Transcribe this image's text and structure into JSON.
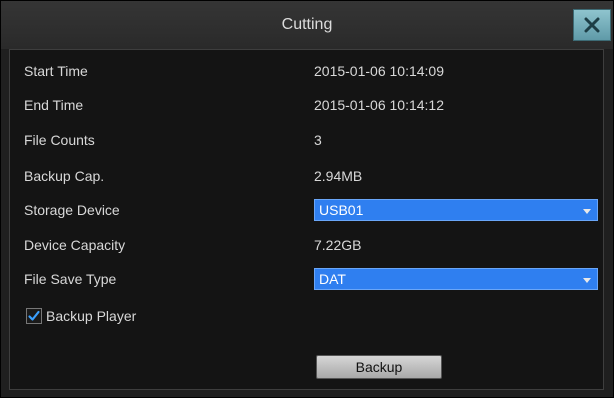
{
  "dialog": {
    "title": "Cutting",
    "close_icon": "close-x-icon",
    "accent_color": "#2f7ff0"
  },
  "fields": {
    "start_time": {
      "label": "Start Time",
      "value": "2015-01-06  10:14:09"
    },
    "end_time": {
      "label": "End Time",
      "value": "2015-01-06  10:14:12"
    },
    "file_counts": {
      "label": "File Counts",
      "value": "3"
    },
    "backup_cap": {
      "label": "Backup Cap.",
      "value": "2.94MB"
    },
    "storage_device": {
      "label": "Storage Device",
      "selected": "USB01"
    },
    "device_capacity": {
      "label": "Device Capacity",
      "value": "7.22GB"
    },
    "file_save_type": {
      "label": "File Save Type",
      "selected": "DAT"
    }
  },
  "backup_player": {
    "label": "Backup Player",
    "checked": true
  },
  "actions": {
    "backup_label": "Backup"
  }
}
